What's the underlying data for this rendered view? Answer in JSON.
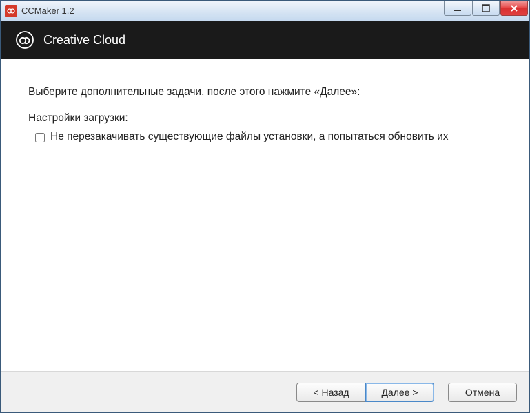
{
  "window": {
    "title": "CCMaker 1.2"
  },
  "header": {
    "title": "Creative Cloud"
  },
  "content": {
    "instruction": "Выберите дополнительные задачи, после этого нажмите «Далее»:",
    "section_label": "Настройки загрузки:",
    "option1_label": "Не перезакачивать существующие файлы установки, а попытаться обновить их"
  },
  "footer": {
    "back": "< Назад",
    "next": "Далее >",
    "cancel": "Отмена"
  }
}
